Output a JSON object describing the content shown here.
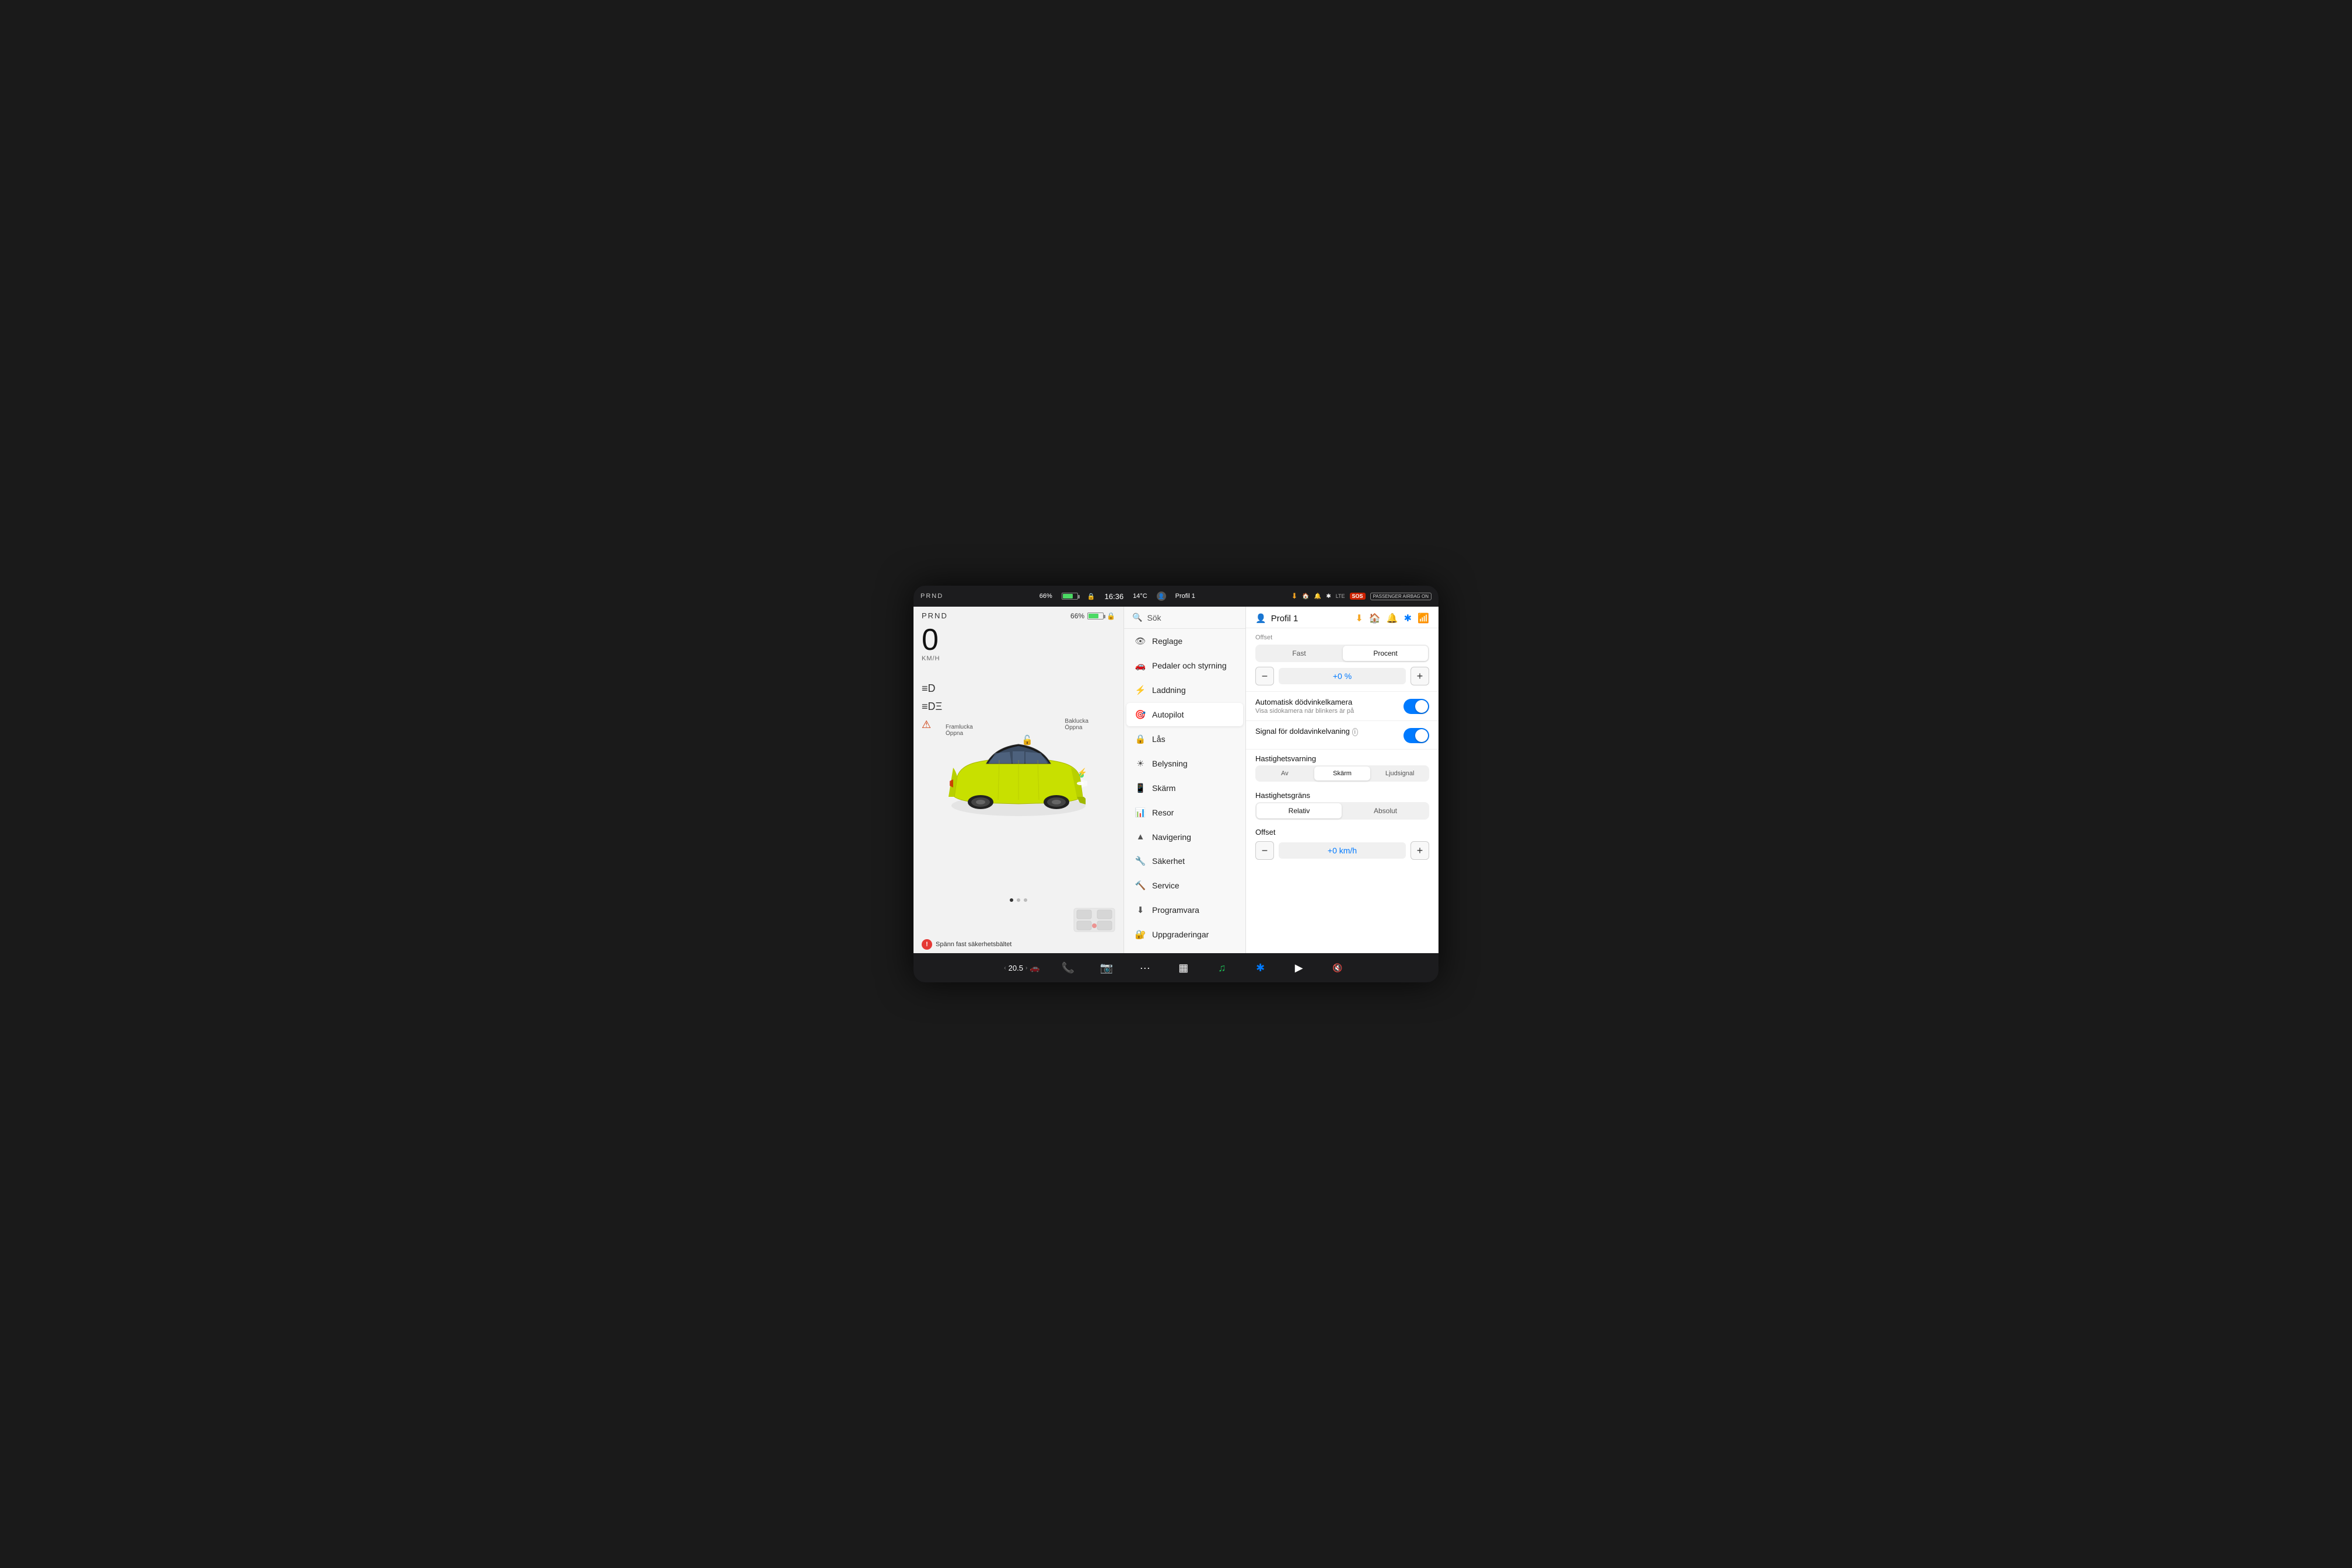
{
  "statusBar": {
    "prnd": "PRND",
    "battery": "66%",
    "lock": "🔒",
    "time": "16:36",
    "temp": "14°C",
    "profile": "Profil 1",
    "sos": "SOS",
    "passenger": "PASSENGER AIRBAG ON",
    "lte": "LTE"
  },
  "leftPanel": {
    "speed": "0",
    "speedUnit": "KM/H",
    "warningText": "Spänn fast säkerhetsbältet",
    "framluckaLabel": "Framlucka\nÖppna",
    "bakluckaLabel": "Baklucka\nÖppna"
  },
  "menuPanel": {
    "searchPlaceholder": "Sök",
    "items": [
      {
        "id": "reglage",
        "label": "Reglage",
        "icon": "👁"
      },
      {
        "id": "pedaler",
        "label": "Pedaler och styrning",
        "icon": "🚗"
      },
      {
        "id": "laddning",
        "label": "Laddning",
        "icon": "⚡"
      },
      {
        "id": "autopilot",
        "label": "Autopilot",
        "icon": "🎯",
        "active": true
      },
      {
        "id": "las",
        "label": "Lås",
        "icon": "🔒"
      },
      {
        "id": "belysning",
        "label": "Belysning",
        "icon": "☀"
      },
      {
        "id": "skarm",
        "label": "Skärm",
        "icon": "📱"
      },
      {
        "id": "resor",
        "label": "Resor",
        "icon": "📊"
      },
      {
        "id": "navigering",
        "label": "Navigering",
        "icon": "🧭"
      },
      {
        "id": "sakerhet",
        "label": "Säkerhet",
        "icon": "🛡"
      },
      {
        "id": "service",
        "label": "Service",
        "icon": "🔧"
      },
      {
        "id": "programvara",
        "label": "Programvara",
        "icon": "⬇"
      },
      {
        "id": "uppgraderingar",
        "label": "Uppgraderingar",
        "icon": "🔐"
      }
    ]
  },
  "settingsPanel": {
    "profileName": "Profil 1",
    "offsetLabel": "Offset",
    "offsetToggle": {
      "fast": "Fast",
      "procent": "Procent",
      "activeIndex": 1
    },
    "offsetValue": "+0 %",
    "toggles": [
      {
        "id": "dodvinkelkamera",
        "title": "Automatisk dödvinkelkamera",
        "subtitle": "Visa sidokamera när blinkers är på",
        "enabled": true
      },
      {
        "id": "doldavinkelvarning",
        "title": "Signal för doldavinkelvaning",
        "subtitle": "",
        "enabled": true,
        "info": true
      }
    ],
    "hastighetsvarning": {
      "label": "Hastighetsvarning",
      "options": [
        "Av",
        "Skärm",
        "Ljudsignal"
      ],
      "activeIndex": 1
    },
    "hastighetsgrans": {
      "label": "Hastighetsgräns",
      "options": [
        "Relativ",
        "Absolut"
      ],
      "activeIndex": 0
    },
    "offsetKmh": {
      "label": "Offset",
      "value": "+0 km/h"
    }
  },
  "taskbar": {
    "speedValue": "20.5",
    "icons": [
      "phone",
      "camera",
      "dots",
      "grid",
      "spotify",
      "bluetooth",
      "music",
      "volume"
    ]
  }
}
